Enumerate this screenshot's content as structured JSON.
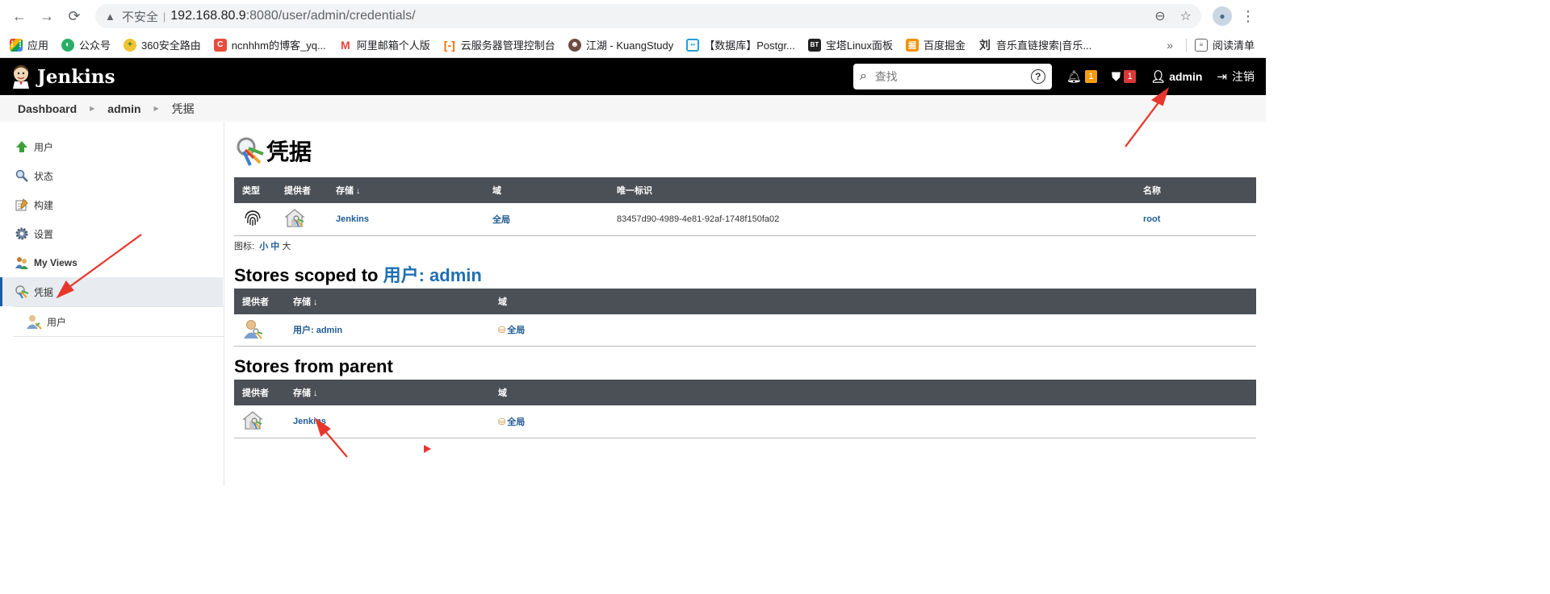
{
  "browser": {
    "insecure_label": "不安全",
    "url_host": "192.168.80.9",
    "url_path": ":8080/user/admin/credentials/",
    "bookmarks": [
      {
        "label": "应用",
        "icon": "apps-grid-icon",
        "color": "#e0452d"
      },
      {
        "label": "公众号",
        "icon": "wechat-icon",
        "color": "#2aae67"
      },
      {
        "label": "360安全路由",
        "icon": "router-360-icon",
        "color": "#f1c232"
      },
      {
        "label": "ncnhhm的博客_yq...",
        "icon": "csdn-c-icon",
        "color": "#e74c3c"
      },
      {
        "label": "阿里邮箱个人版",
        "icon": "mail-m-icon",
        "color": "#e8433a"
      },
      {
        "label": "云服务器管理控制台",
        "icon": "aliyun-icon",
        "color": "#ff6a00"
      },
      {
        "label": "江湖 - KuangStudy",
        "icon": "kuang-avatar-icon",
        "color": "#6d4c41"
      },
      {
        "label": "【数据库】Postgr...",
        "icon": "bilibili-icon",
        "color": "#23a0d6"
      },
      {
        "label": "宝塔Linux面板",
        "icon": "bt-icon",
        "color": "#222222"
      },
      {
        "label": "百度掘金",
        "icon": "juejin-icon",
        "color": "#f29100"
      },
      {
        "label": "音乐直链搜索|音乐...",
        "icon": "music-liu-icon",
        "color": "#333333"
      }
    ],
    "more_label": "»",
    "reading_list_label": "阅读清单"
  },
  "jenkins": {
    "brand": "Jenkins",
    "search_placeholder": "查找",
    "notifications_count": "1",
    "security_count": "1",
    "user": "admin",
    "logout_label": "注销"
  },
  "breadcrumb": [
    "Dashboard",
    "admin",
    "凭据"
  ],
  "sidebar": {
    "items": [
      {
        "label": "用户",
        "icon": "up-arrow-icon"
      },
      {
        "label": "状态",
        "icon": "magnifier-icon"
      },
      {
        "label": "构建",
        "icon": "notepad-icon"
      },
      {
        "label": "设置",
        "icon": "gear-icon"
      },
      {
        "label": "My Views",
        "icon": "people-icon"
      },
      {
        "label": "凭据",
        "icon": "credentials-keys-icon"
      }
    ],
    "sub_items": [
      {
        "label": "用户",
        "icon": "user-credentials-icon"
      }
    ]
  },
  "main": {
    "title": "凭据",
    "credentials_table": {
      "headers": [
        "类型",
        "提供者",
        "存储 ↓",
        "域",
        "唯一标识",
        "名称"
      ],
      "rows": [
        {
          "type_icon": "fingerprint-icon",
          "provider_icon": "house-keys-icon",
          "store": "Jenkins",
          "domain": "全局",
          "id": "83457d90-4989-4e81-92af-1748f150fa02",
          "name": "root"
        }
      ]
    },
    "icon_size": {
      "label": "图标:",
      "small": "小",
      "medium": "中",
      "large": "大"
    },
    "user_scoped": {
      "heading_prefix": "Stores scoped to ",
      "heading_link": "用户: admin",
      "headers": [
        "提供者",
        "存储 ↓",
        "域"
      ],
      "rows": [
        {
          "provider_icon": "user-keys-icon",
          "store": "用户: admin",
          "domain": "全局"
        }
      ]
    },
    "parent": {
      "heading": "Stores from parent",
      "headers": [
        "提供者",
        "存储 ↓",
        "域"
      ],
      "rows": [
        {
          "provider_icon": "house-keys-icon",
          "store": "Jenkins",
          "domain": "全局"
        }
      ]
    }
  },
  "colors": {
    "header_bg": "#000000",
    "table_header_bg": "#4b4f56",
    "link": "#1f5a94",
    "annotation_arrow": "#e8362d",
    "active_sidebar_border": "#1a5ea6"
  }
}
